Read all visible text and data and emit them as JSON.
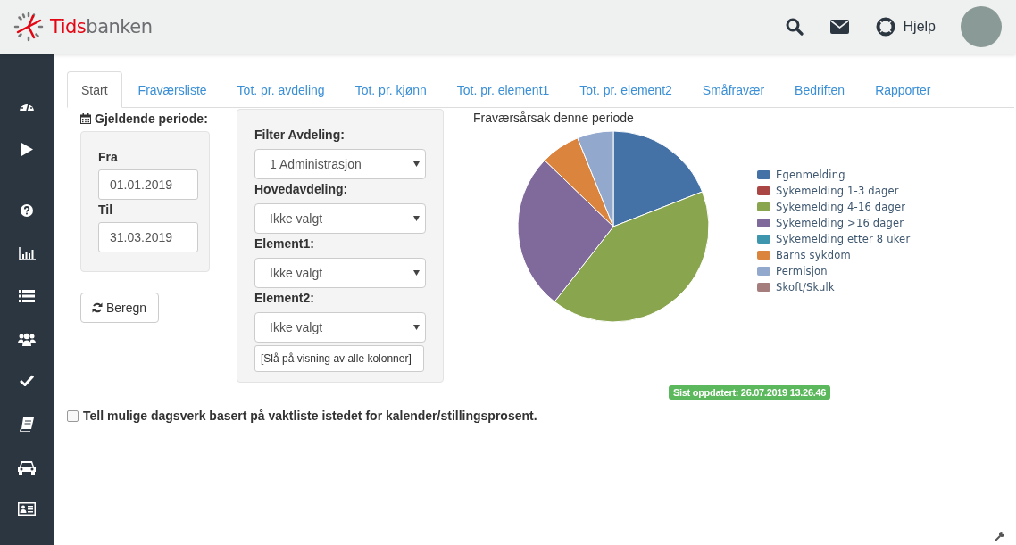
{
  "header": {
    "logo_part1": "Tids",
    "logo_part2": "banken",
    "help": "Hjelp"
  },
  "sidebar": {
    "items": [
      {
        "kind": "dashboard"
      },
      {
        "kind": "play"
      },
      {
        "kind": "help"
      },
      {
        "kind": "chart"
      },
      {
        "kind": "list"
      },
      {
        "kind": "users"
      },
      {
        "kind": "check"
      },
      {
        "kind": "book"
      },
      {
        "kind": "car"
      },
      {
        "kind": "card"
      }
    ]
  },
  "tabs": [
    {
      "label": "Start",
      "selected": true
    },
    {
      "label": "Fraværsliste",
      "selected": false
    },
    {
      "label": "Tot. pr. avdeling",
      "selected": false
    },
    {
      "label": "Tot. pr. kjønn",
      "selected": false
    },
    {
      "label": "Tot. pr. element1",
      "selected": false
    },
    {
      "label": "Tot. pr. element2",
      "selected": false
    },
    {
      "label": "Småfravær",
      "selected": false
    },
    {
      "label": "Bedriften",
      "selected": false
    },
    {
      "label": "Rapporter",
      "selected": false
    }
  ],
  "period": {
    "title": "Gjeldende periode:",
    "from_label": "Fra",
    "from": "01.01.2019",
    "to_label": "Til",
    "to": "31.03.2019",
    "button": "Beregn"
  },
  "filters": [
    {
      "label": "Filter Avdeling:",
      "value": "1 Administrasjon"
    },
    {
      "label": "Hovedavdeling:",
      "value": "Ikke valgt"
    },
    {
      "label": "Element1:",
      "value": "Ikke valgt"
    },
    {
      "label": "Element2:",
      "value": "Ikke valgt"
    }
  ],
  "columns_button": "[Slå på visning av alle kolonner]",
  "chart": {
    "title": "Fraværsårsak denne periode",
    "legend": [
      {
        "label": "Egenmelding",
        "color": "#4471a6"
      },
      {
        "label": "Sykemelding 1-3 dager",
        "color": "#aa4643"
      },
      {
        "label": "Sykemelding 4-16 dager",
        "color": "#89a54e"
      },
      {
        "label": "Sykemelding >16 dager",
        "color": "#80699b"
      },
      {
        "label": "Sykemelding etter 8 uker",
        "color": "#3d96ae"
      },
      {
        "label": "Barns sykdom",
        "color": "#db843d"
      },
      {
        "label": "Permisjon",
        "color": "#92a8cd"
      },
      {
        "label": "Skoft/Skulk",
        "color": "#a47d7c"
      }
    ]
  },
  "updated": "Sist oppdatert: 26.07.2019 13.26.46",
  "option": {
    "label": "Tell mulige dagsverk basert på vaktliste istedet for kalender/stillingsprosent.",
    "checked": false
  }
}
